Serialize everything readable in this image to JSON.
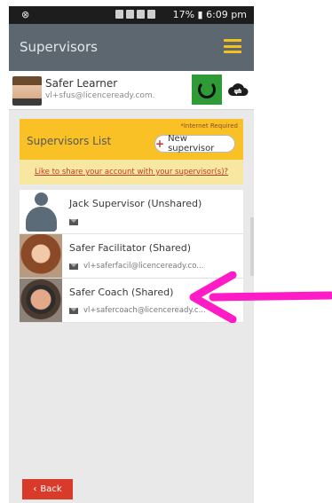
{
  "status_bar": {
    "left_icon": "sync-status-icon",
    "battery": "17%",
    "time": "6:09 pm"
  },
  "appbar": {
    "title": "Supervisors",
    "menu_icon": "hamburger-icon"
  },
  "user": {
    "name": "Safer Learner",
    "email": "vl+sfus@licenceready.com."
  },
  "panel": {
    "title": "Supervisors List",
    "internet_required": "*Internet Required",
    "new_supervisor_label": "New supervisor",
    "share_link": "Like to share your account with your supervisor(s)?"
  },
  "supervisors": [
    {
      "name": "Jack Supervisor (Unshared)",
      "email": ""
    },
    {
      "name": "Safer Facilitator (Shared)",
      "email": "vl+saferfacil@licenceready.co..."
    },
    {
      "name": "Safer Coach (Shared)",
      "email": "vl+safercoach@licenceready.c..."
    }
  ],
  "back_label": "Back",
  "colors": {
    "appbar": "#5c6770",
    "accent_yellow": "#f9c126",
    "share_bar": "#f8e7a1",
    "back_red": "#d93b2a",
    "sync_green": "#2e9b36",
    "annotation_arrow": "#ff1cc6"
  }
}
